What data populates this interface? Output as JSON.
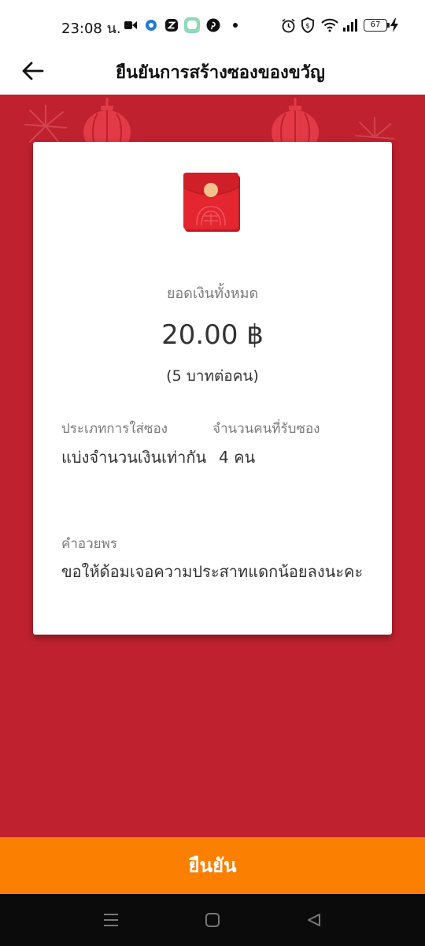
{
  "status_bar": {
    "time": "23:08 น.",
    "battery": "67"
  },
  "header": {
    "title": "ยืนยันการสร้างซองของขวัญ"
  },
  "card": {
    "total_label": "ยอดเงินทั้งหมด",
    "total_amount": "20.00 ฿",
    "per_person": "(5 บาทต่อคน)",
    "type_label": "ประเภทการใส่ซอง",
    "type_value": "แบ่งจำนวนเงินเท่ากัน",
    "recipients_label": "จำนวนคนที่รับซอง",
    "recipients_value": "4 คน",
    "message_label": "คำอวยพร",
    "message_value": "ขอให้ด้อมเจอความประสาทแดกน้อยลงนะคะ"
  },
  "confirm_button": "ยืนยัน",
  "icons": {
    "back": "arrow-left-icon",
    "envelope": "red-envelope-icon",
    "nav_menu": "menu-icon",
    "nav_home": "home-square-icon",
    "nav_back": "triangle-back-icon"
  },
  "colors": {
    "background_red": "#c0212f",
    "confirm_orange": "#fb7f00",
    "envelope_red": "#e32630",
    "seal_gold": "#f2c38c"
  }
}
